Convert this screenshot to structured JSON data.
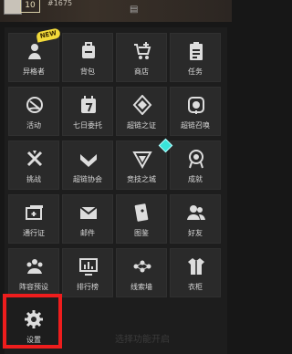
{
  "header": {
    "level": "10",
    "uid": "#1675"
  },
  "badge": {
    "new": "NEW"
  },
  "grid": [
    {
      "label": "异格者",
      "icon": "heterotype-icon"
    },
    {
      "label": "背包",
      "icon": "backpack-icon"
    },
    {
      "label": "商店",
      "icon": "shop-cart-icon"
    },
    {
      "label": "任务",
      "icon": "task-clipboard-icon"
    },
    {
      "label": "活动",
      "icon": "activity-icon"
    },
    {
      "label": "七日委托",
      "icon": "calendar-seven-icon"
    },
    {
      "label": "超链之证",
      "icon": "hyperlink-badge-icon"
    },
    {
      "label": "超链召唤",
      "icon": "summon-icon"
    },
    {
      "label": "挑战",
      "icon": "challenge-icon"
    },
    {
      "label": "超链协会",
      "icon": "association-icon"
    },
    {
      "label": "竞技之城",
      "icon": "arena-city-icon"
    },
    {
      "label": "成就",
      "icon": "achievement-icon"
    },
    {
      "label": "通行证",
      "icon": "pass-card-icon"
    },
    {
      "label": "邮件",
      "icon": "mail-icon"
    },
    {
      "label": "图鉴",
      "icon": "collection-card-icon"
    },
    {
      "label": "好友",
      "icon": "friends-icon"
    },
    {
      "label": "阵容预设",
      "icon": "lineup-preset-icon"
    },
    {
      "label": "排行榜",
      "icon": "leaderboard-icon"
    },
    {
      "label": "线索墙",
      "icon": "clue-wall-icon"
    },
    {
      "label": "衣柜",
      "icon": "wardrobe-icon"
    },
    {
      "label": "设置",
      "icon": "gear-icon"
    }
  ],
  "hint": "选择功能开启"
}
